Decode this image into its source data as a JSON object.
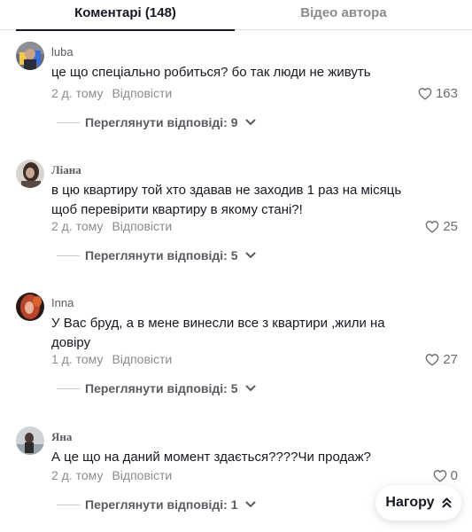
{
  "tabs": {
    "comments": "Коментарі (148)",
    "author_videos": "Відео автора"
  },
  "comments": [
    {
      "username": "luba",
      "text": "це що спеціально робиться? бо так люди не живуть",
      "time": "2 д. тому",
      "reply": "Відповісти",
      "likes": "163",
      "view_replies": "Переглянути відповіді: 9"
    },
    {
      "username": "Ліана",
      "text": "в цю квартиру той хто здавав не заходив 1 раз на місяць щоб перевірити квартиру в якому стані?!",
      "time": "2 д. тому",
      "reply": "Відповісти",
      "likes": "25",
      "view_replies": "Переглянути відповіді: 5"
    },
    {
      "username": "Inna",
      "text": "У Вас бруд, а в мене винесли все з квартири ,жили на довіру",
      "time": "1 д. тому",
      "reply": "Відповісти",
      "likes": "27",
      "view_replies": "Переглянути відповіді: 5"
    },
    {
      "username": "Яна",
      "text": "А це що на даний момент здається????Чи продаж?",
      "time": "2 д. тому",
      "reply": "Відповісти",
      "likes": "0",
      "view_replies": "Переглянути відповіді: 1"
    }
  ],
  "back_to_top": "Нагору",
  "icons": {
    "like": "heart-outline-icon",
    "expand": "chevron-down-icon",
    "top": "double-chevron-up-icon"
  },
  "colors": {
    "text_primary": "#161823",
    "text_secondary": "#8a8b91",
    "divider": "#e3e3e4"
  }
}
